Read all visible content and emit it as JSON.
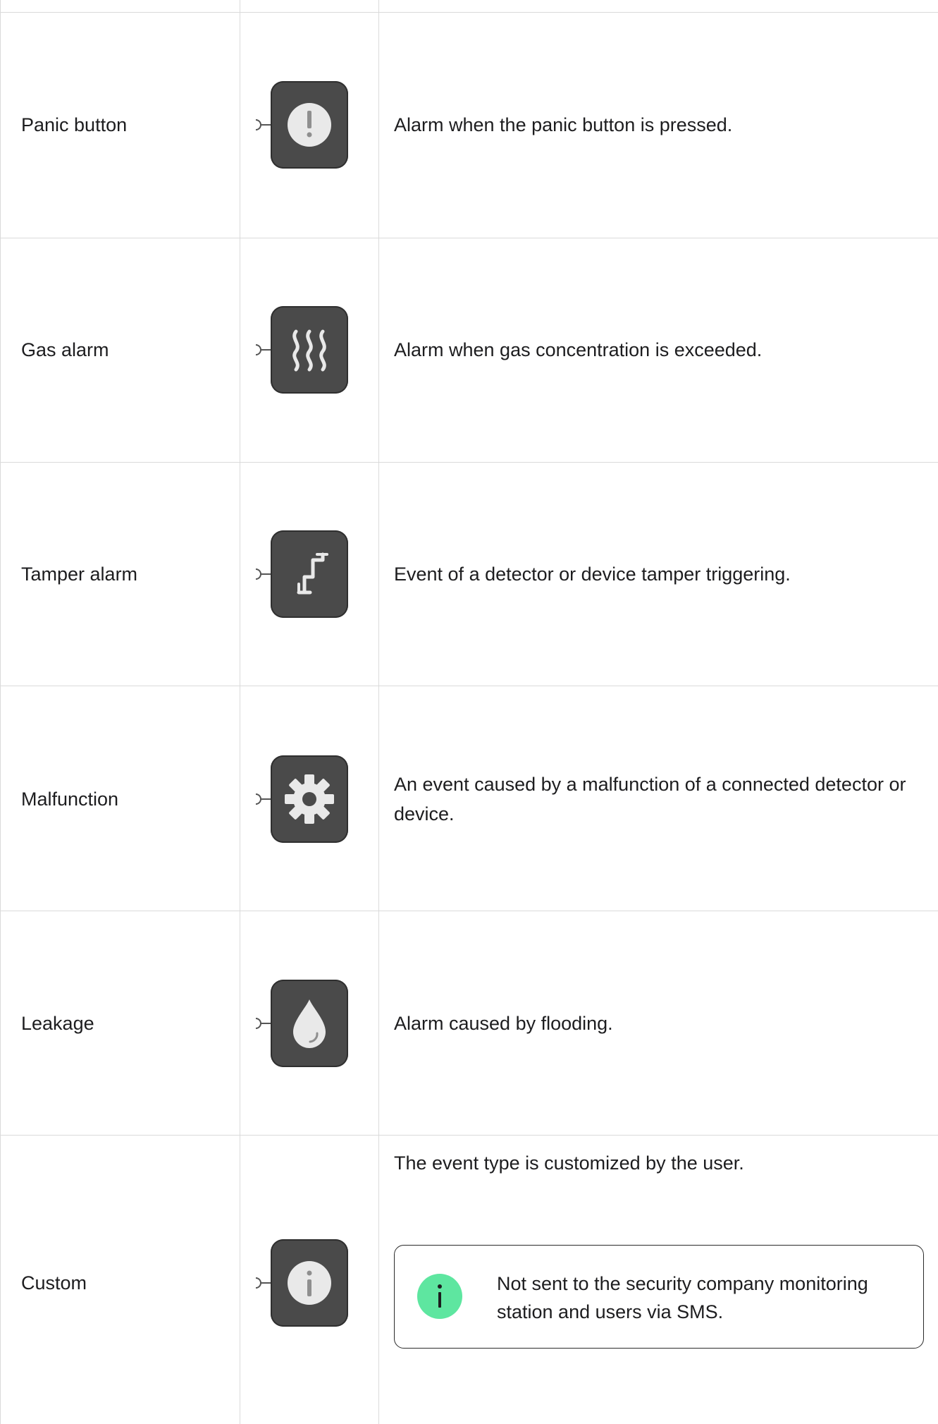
{
  "rows": [
    {
      "name": "Panic button",
      "icon": "exclamation-icon",
      "description": "Alarm when the panic button is pressed."
    },
    {
      "name": "Gas alarm",
      "icon": "gas-waves-icon",
      "description": "Alarm when gas concentration is exceeded."
    },
    {
      "name": "Tamper alarm",
      "icon": "tamper-icon",
      "description": "Event of a detector or device tamper triggering."
    },
    {
      "name": "Malfunction",
      "icon": "gear-icon",
      "description": "An event caused by a malfunction of a connected detector or device."
    },
    {
      "name": "Leakage",
      "icon": "water-drop-icon",
      "description": "Alarm caused by flooding."
    },
    {
      "name": "Custom",
      "icon": "info-icon",
      "description": "The event type is customized by the user."
    }
  ],
  "note": {
    "icon": "info-icon",
    "text": "Not sent to the security company monitoring station and users via SMS."
  },
  "colors": {
    "tile": "#4a4a4a",
    "icon_fill": "#e9e9e9",
    "note_accent": "#5ee6a0",
    "grid": "#dadada"
  }
}
